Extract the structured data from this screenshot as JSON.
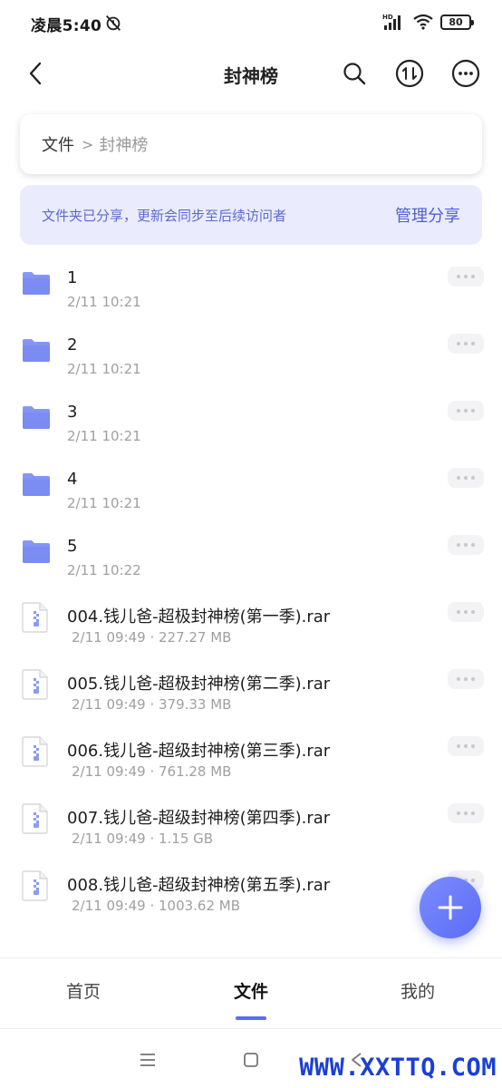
{
  "status": {
    "time": "凌晨5:40",
    "network": "HD",
    "battery": "80"
  },
  "header": {
    "title": "封神榜",
    "icons": [
      "back-icon",
      "search-icon",
      "sort-icon",
      "more-icon"
    ]
  },
  "breadcrumb": {
    "root": "文件",
    "separator": ">",
    "current": "封神榜"
  },
  "share_banner": {
    "text": "文件夹已分享，更新会同步至后续访问者",
    "action": "管理分享"
  },
  "files": [
    {
      "name": "1",
      "meta": "2/11 10:21",
      "type": "folder"
    },
    {
      "name": "2",
      "meta": "2/11 10:21",
      "type": "folder"
    },
    {
      "name": "3",
      "meta": "2/11 10:21",
      "type": "folder"
    },
    {
      "name": "4",
      "meta": "2/11 10:21",
      "type": "folder"
    },
    {
      "name": "5",
      "meta": "2/11 10:22",
      "type": "folder"
    },
    {
      "name": "004.钱儿爸-超极封神榜(第一季).rar",
      "meta": "2/11 09:49 · 227.27 MB",
      "type": "archive"
    },
    {
      "name": "005.钱儿爸-超极封神榜(第二季).rar",
      "meta": "2/11 09:49 · 379.33 MB",
      "type": "archive"
    },
    {
      "name": "006.钱儿爸-超级封神榜(第三季).rar",
      "meta": "2/11 09:49 · 761.28 MB",
      "type": "archive"
    },
    {
      "name": "007.钱儿爸-超级封神榜(第四季).rar",
      "meta": "2/11 09:49 · 1.15 GB",
      "type": "archive"
    },
    {
      "name": "008.钱儿爸-超级封神榜(第五季).rar",
      "meta": "2/11 09:49 · 1003.62 MB",
      "type": "archive"
    }
  ],
  "tabs": [
    {
      "label": "首页",
      "active": false
    },
    {
      "label": "文件",
      "active": true
    },
    {
      "label": "我的",
      "active": false
    }
  ],
  "colors": {
    "accent": "#5a6cf5",
    "banner_bg": "#eaecfd",
    "folder": "#7b8cf2"
  },
  "watermark": "WWW.XXTTQ.COM"
}
